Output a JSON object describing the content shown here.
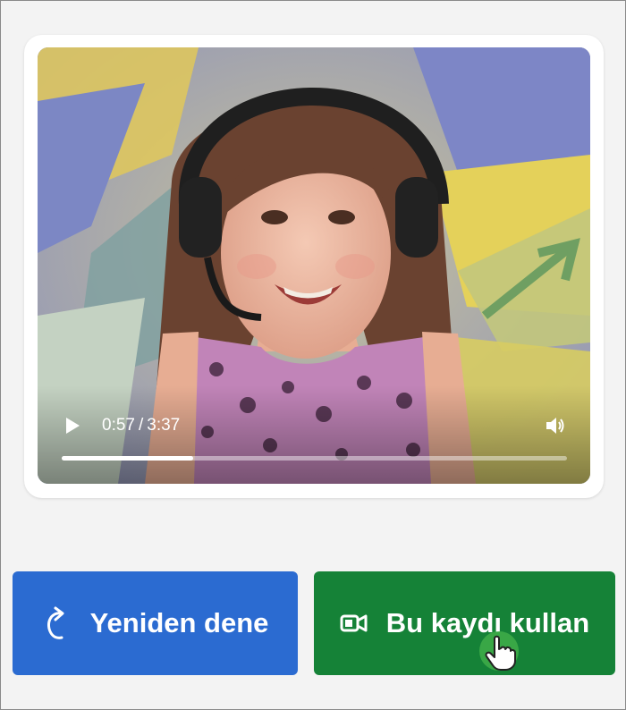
{
  "video": {
    "subject": "child-wearing-headset",
    "current_time": "0:57",
    "separator": "/",
    "duration": "3:37",
    "progress_fraction": 0.26,
    "play_icon": "play-icon",
    "volume_icon": "speaker-icon"
  },
  "buttons": {
    "retry_label": "Yeniden dene",
    "retry_icon": "redo-arrow-icon",
    "retry_color": "#2b6bd1",
    "use_label": "Bu kaydı kullan",
    "use_icon": "video-camera-icon",
    "use_color": "#158237"
  },
  "cursor": {
    "icon": "hand-pointer-icon",
    "highlight_color": "#3fae49"
  }
}
